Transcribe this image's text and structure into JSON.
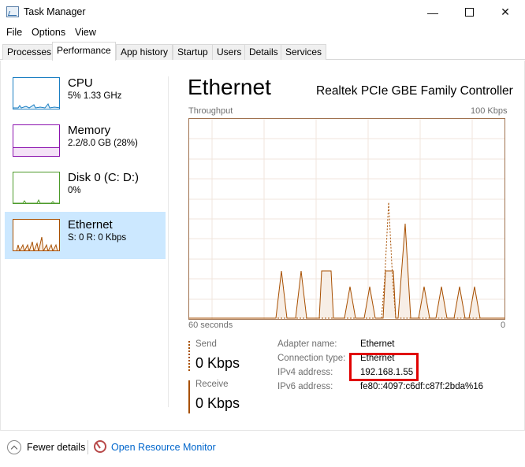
{
  "window": {
    "title": "Task Manager",
    "min_glyph": "—",
    "close_glyph": "✕"
  },
  "menu": [
    "File",
    "Options",
    "View"
  ],
  "tabs": [
    "Processes",
    "Performance",
    "App history",
    "Startup",
    "Users",
    "Details",
    "Services"
  ],
  "active_tab": "Performance",
  "sidebar": {
    "items": [
      {
        "title": "CPU",
        "subtitle": "5%  1.33 GHz",
        "color": "#1a7ec2"
      },
      {
        "title": "Memory",
        "subtitle": "2.2/8.0 GB (28%)",
        "color": "#8b12ae"
      },
      {
        "title": "Disk 0 (C: D:)",
        "subtitle": "0%",
        "color": "#4c9a2a"
      },
      {
        "title": "Ethernet",
        "subtitle": "S: 0  R: 0 Kbps",
        "color": "#a74f01"
      }
    ],
    "selected": "Ethernet",
    "selected_bg": "#cce8ff"
  },
  "detail": {
    "title": "Ethernet",
    "adapter_model": "Realtek PCIe GBE Family Controller",
    "graph_label": "Throughput",
    "graph_max": "100 Kbps",
    "time_label": "60 seconds",
    "zero_label": "0",
    "send_label": "Send",
    "send_value": "0 Kbps",
    "receive_label": "Receive",
    "receive_value": "0 Kbps",
    "info": {
      "adapter_name_label": "Adapter name:",
      "adapter_name": "Ethernet",
      "connection_type_label": "Connection type:",
      "connection_type": "Ethernet",
      "ipv4_label": "IPv4 address:",
      "ipv4": "192.168.1.55",
      "ipv6_label": "IPv6 address:",
      "ipv6": "fe80::4097:c6df:c87f:2bda%16"
    },
    "accent_color": "#a74f01"
  },
  "footer": {
    "fewer_details": "Fewer details",
    "open_resource_monitor": "Open Resource Monitor"
  }
}
